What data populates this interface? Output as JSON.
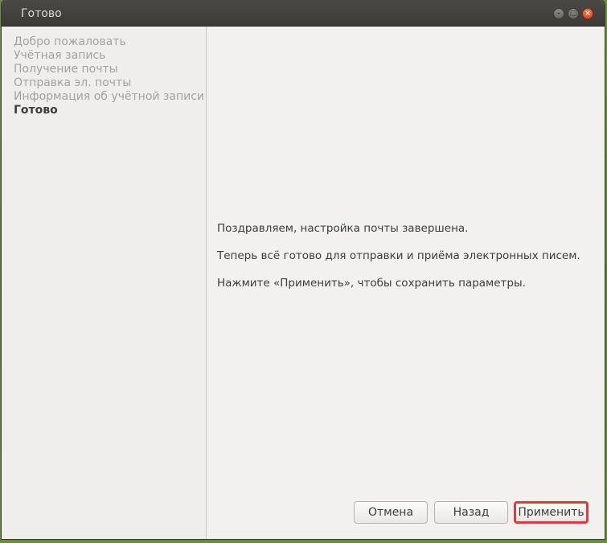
{
  "window": {
    "title": "Готово",
    "controls": {
      "minimize": "–",
      "maximize": "□",
      "close": "×"
    }
  },
  "sidebar": {
    "items": [
      {
        "label": "Добро пожаловать"
      },
      {
        "label": "Учётная запись"
      },
      {
        "label": "Получение почты"
      },
      {
        "label": "Отправка эл. почты"
      },
      {
        "label": "Информация об учётной записи"
      },
      {
        "label": "Готово",
        "current": true
      }
    ]
  },
  "content": {
    "line1": "Поздравляем, настройка почты завершена.",
    "line2": "Теперь всё готово для отправки и приёма электронных писем.",
    "line3": "Нажмите «Применить», чтобы сохранить параметры."
  },
  "buttons": {
    "cancel": "Отмена",
    "back": "Назад",
    "apply": "Применить"
  },
  "colors": {
    "highlight": "#e23a3a"
  }
}
